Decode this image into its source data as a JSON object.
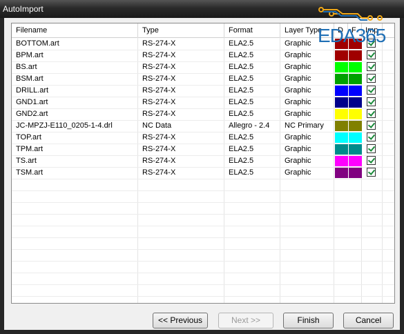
{
  "window": {
    "title": "AutoImport"
  },
  "watermark": "EDA365",
  "grid": {
    "headers": [
      "Filename",
      "Type",
      "Format",
      "Layer Type",
      "D",
      "F",
      "Imp"
    ],
    "rows": [
      {
        "filename": "BOTTOM.art",
        "type": "RS-274-X",
        "format": "ELA2.5",
        "layer_type": "Graphic",
        "color": "#a00000",
        "imp": true
      },
      {
        "filename": "BPM.art",
        "type": "RS-274-X",
        "format": "ELA2.5",
        "layer_type": "Graphic",
        "color": "#a00000",
        "imp": true
      },
      {
        "filename": "BS.art",
        "type": "RS-274-X",
        "format": "ELA2.5",
        "layer_type": "Graphic",
        "color": "#00ff00",
        "imp": true
      },
      {
        "filename": "BSM.art",
        "type": "RS-274-X",
        "format": "ELA2.5",
        "layer_type": "Graphic",
        "color": "#00a000",
        "imp": true
      },
      {
        "filename": "DRILL.art",
        "type": "RS-274-X",
        "format": "ELA2.5",
        "layer_type": "Graphic",
        "color": "#0000ff",
        "imp": true
      },
      {
        "filename": "GND1.art",
        "type": "RS-274-X",
        "format": "ELA2.5",
        "layer_type": "Graphic",
        "color": "#00008b",
        "imp": true
      },
      {
        "filename": "GND2.art",
        "type": "RS-274-X",
        "format": "ELA2.5",
        "layer_type": "Graphic",
        "color": "#ffff00",
        "imp": true
      },
      {
        "filename": "JC-MPZJ-E110_0205-1-4.drl",
        "type": "NC Data",
        "format": "Allegro - 2.4",
        "layer_type": "NC Primary",
        "color": "#808000",
        "imp": true
      },
      {
        "filename": "TOP.art",
        "type": "RS-274-X",
        "format": "ELA2.5",
        "layer_type": "Graphic",
        "color": "#00ffff",
        "imp": true
      },
      {
        "filename": "TPM.art",
        "type": "RS-274-X",
        "format": "ELA2.5",
        "layer_type": "Graphic",
        "color": "#008b8b",
        "imp": true
      },
      {
        "filename": "TS.art",
        "type": "RS-274-X",
        "format": "ELA2.5",
        "layer_type": "Graphic",
        "color": "#ff00ff",
        "imp": true
      },
      {
        "filename": "TSM.art",
        "type": "RS-274-X",
        "format": "ELA2.5",
        "layer_type": "Graphic",
        "color": "#800080",
        "imp": true
      }
    ]
  },
  "buttons": {
    "previous": "<< Previous",
    "next": "Next >>",
    "finish": "Finish",
    "cancel": "Cancel"
  }
}
